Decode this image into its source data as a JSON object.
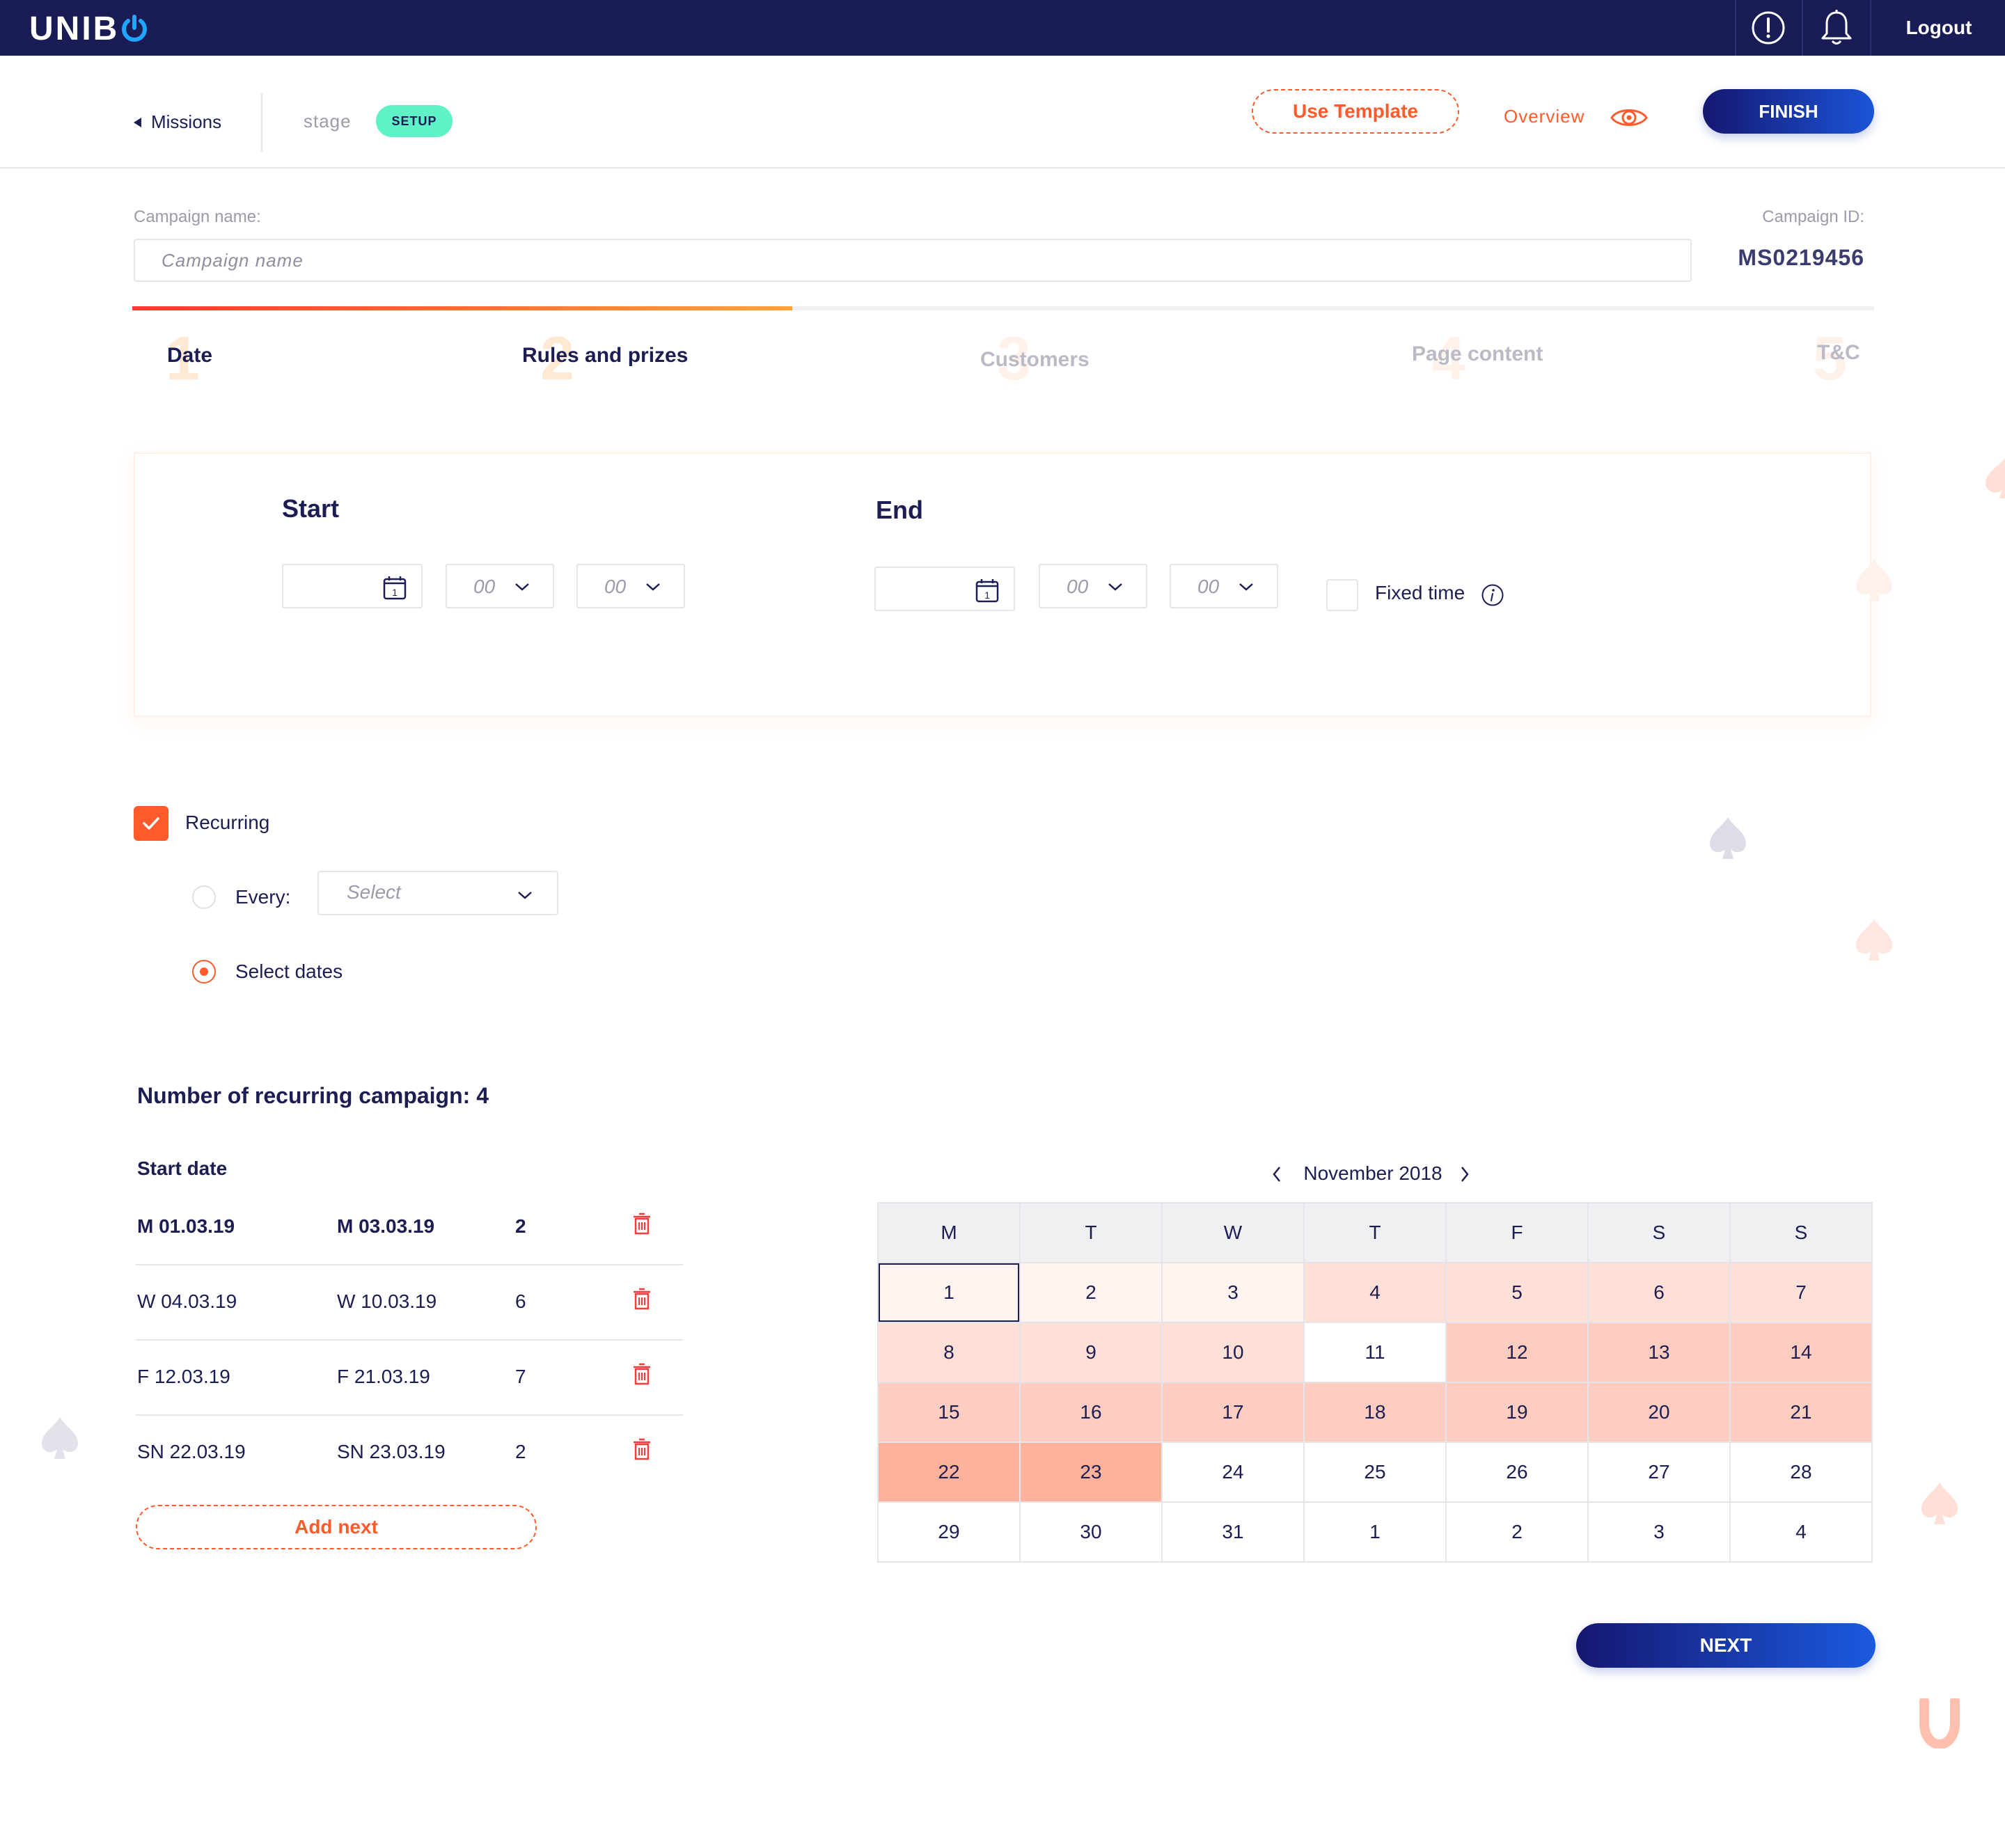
{
  "topbar": {
    "logo": "UNIB",
    "logout_label": "Logout",
    "icons": [
      "alert-icon",
      "bell-icon"
    ]
  },
  "header": {
    "back_label": "Missions",
    "stage_label": "stage",
    "stage_badge": "SETUP",
    "use_template_label": "Use Template",
    "overview_label": "Overview",
    "finish_label": "FINISH"
  },
  "campaign": {
    "name_label": "Campaign name:",
    "name_placeholder": "Campaign name",
    "name_value": "",
    "id_label": "Campaign ID:",
    "id_value": "MS0219456"
  },
  "steps": [
    {
      "number": "1",
      "label": "Date",
      "state": "active"
    },
    {
      "number": "2",
      "label": "Rules and prizes",
      "state": "active"
    },
    {
      "number": "3",
      "label": "Customers",
      "state": "inactive"
    },
    {
      "number": "4",
      "label": "Page content",
      "state": "inactive"
    },
    {
      "number": "5",
      "label": "T&C",
      "state": "inactive"
    }
  ],
  "date_card": {
    "start_title": "Start",
    "end_title": "End",
    "hour_placeholder": "00",
    "minute_placeholder": "00",
    "calendar_day_glyph": "1",
    "fixed_time_label": "Fixed time",
    "fixed_time_checked": false
  },
  "recurring": {
    "label": "Recurring",
    "checked": true,
    "every_label": "Every:",
    "every_selected": false,
    "select_placeholder": "Select",
    "select_dates_label": "Select dates",
    "select_dates_selected": true
  },
  "recurring_list": {
    "title": "Number of recurring campaign: 4",
    "start_date_header": "Start date",
    "rows": [
      {
        "start": "M 01.03.19",
        "end": "M 03.03.19",
        "count": "2"
      },
      {
        "start": "W 04.03.19",
        "end": "W 10.03.19",
        "count": "6"
      },
      {
        "start": "F 12.03.19",
        "end": "F 21.03.19",
        "count": "7"
      },
      {
        "start": "SN 22.03.19",
        "end": "SN 23.03.19",
        "count": "2"
      }
    ],
    "add_next_label": "Add next"
  },
  "calendar": {
    "month_label": "November 2018",
    "weekdays": [
      "M",
      "T",
      "W",
      "T",
      "F",
      "S",
      "S"
    ],
    "days": [
      "1",
      "2",
      "3",
      "4",
      "5",
      "6",
      "7",
      "8",
      "9",
      "10",
      "11",
      "12",
      "13",
      "14",
      "15",
      "16",
      "17",
      "18",
      "19",
      "20",
      "21",
      "22",
      "23",
      "24",
      "25",
      "26",
      "27",
      "28",
      "29",
      "30",
      "31",
      "1",
      "2",
      "3",
      "4"
    ]
  },
  "footer": {
    "next_label": "NEXT"
  },
  "colors": {
    "navy": "#1a1c55",
    "accent": "#ff5a2c",
    "setup_badge": "#5ef2c6",
    "button_gradient_start": "#151770",
    "button_gradient_end": "#1b54d8"
  }
}
